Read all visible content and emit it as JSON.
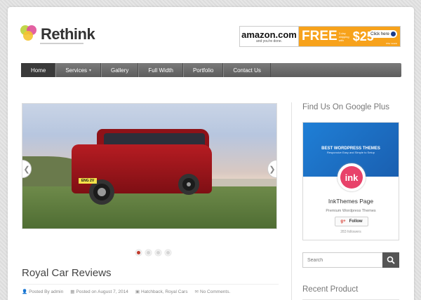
{
  "header": {
    "logo_text": "Rethink",
    "ad": {
      "brand": "amazon.com",
      "brand_sub": "and you're done.",
      "free": "FREE",
      "small": "2-day shipping with",
      "price": "$25",
      "button": "Click here",
      "fine": "Offer details"
    }
  },
  "nav": {
    "items": [
      {
        "label": "Home"
      },
      {
        "label": "Services"
      },
      {
        "label": "Gallery"
      },
      {
        "label": "Full Width"
      },
      {
        "label": "Portfolio"
      },
      {
        "label": "Contact Us"
      }
    ]
  },
  "slider": {
    "plate": "ENG 2V",
    "prev_icon": "chevron-left-icon",
    "next_icon": "chevron-right-icon",
    "active_slide": 1,
    "slide_count": 4
  },
  "post": {
    "title": "Royal Car Reviews",
    "author": "Posted By admin",
    "date": "Posted on August 7, 2014",
    "categories": "Hatchback, Royal Cars",
    "comments": "No Comments."
  },
  "sidebar": {
    "gplus_heading": "Find Us On Google Plus",
    "cover_title": "BEST WORDPRESS THEMES",
    "cover_sub": "Responsive Easy and Simple to Setup",
    "avatar_text": "ink",
    "page_name": "InkThemes Page",
    "page_desc": "Premium Wordpress Themes",
    "follow_label": "Follow",
    "followers": "283 followers",
    "search_placeholder": "Search",
    "recent_heading": "Recent Product"
  },
  "colors": {
    "nav_bg": "#6b6b6b",
    "nav_active": "#3a3a3a",
    "ad_orange": "#f7a21b",
    "gplus_blue": "#1f7fd6",
    "ink_pink": "#e8426a",
    "dot_active": "#c0392b"
  }
}
